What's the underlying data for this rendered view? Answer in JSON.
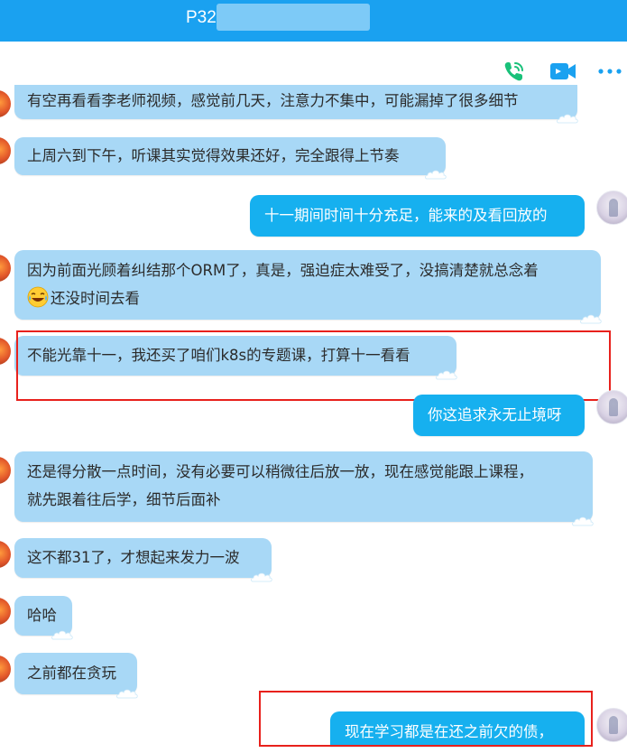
{
  "header": {
    "title": "P32",
    "call_icon": "phone-icon",
    "video_icon": "video-camera-icon",
    "more_icon": "more-dots-icon"
  },
  "colors": {
    "title_bar": "#1aa1f0",
    "incoming_bubble": "#a8d8f6",
    "outgoing_bubble": "#16b0ef",
    "highlight_box": "#e8211c",
    "icon_green": "#19c17a",
    "icon_blue": "#1aa1f0"
  },
  "messages": [
    {
      "side": "in",
      "text": "有空再看看李老师视频，感觉前几天，注意力不集中，可能漏掉了很多细节"
    },
    {
      "side": "in",
      "text": "上周六到下午，听课其实觉得效果还好，完全跟得上节奏"
    },
    {
      "side": "out",
      "text": "十一期间时间十分充足，能来的及看回放的"
    },
    {
      "side": "in",
      "line1": "因为前面光顾着纠结那个ORM了，真是，强迫症太难受了，没搞清楚就总念着",
      "emoji": "laughing-tears-emoji",
      "line2": "还没时间去看"
    },
    {
      "side": "in",
      "text": "不能光靠十一，我还买了咱们k8s的专题课，打算十一看看",
      "highlighted": true
    },
    {
      "side": "out",
      "text": "你这追求永无止境呀"
    },
    {
      "side": "in",
      "line1": "还是得分散一点时间，没有必要可以稍微往后放一放，现在感觉能跟上课程，",
      "line2": "就先跟着往后学，细节后面补"
    },
    {
      "side": "in",
      "text": "这不都31了，才想起来发力一波"
    },
    {
      "side": "in",
      "text": "哈哈"
    },
    {
      "side": "in",
      "text": "之前都在贪玩"
    },
    {
      "side": "out",
      "text": "现在学习都是在还之前欠的债，",
      "highlighted": true
    }
  ]
}
